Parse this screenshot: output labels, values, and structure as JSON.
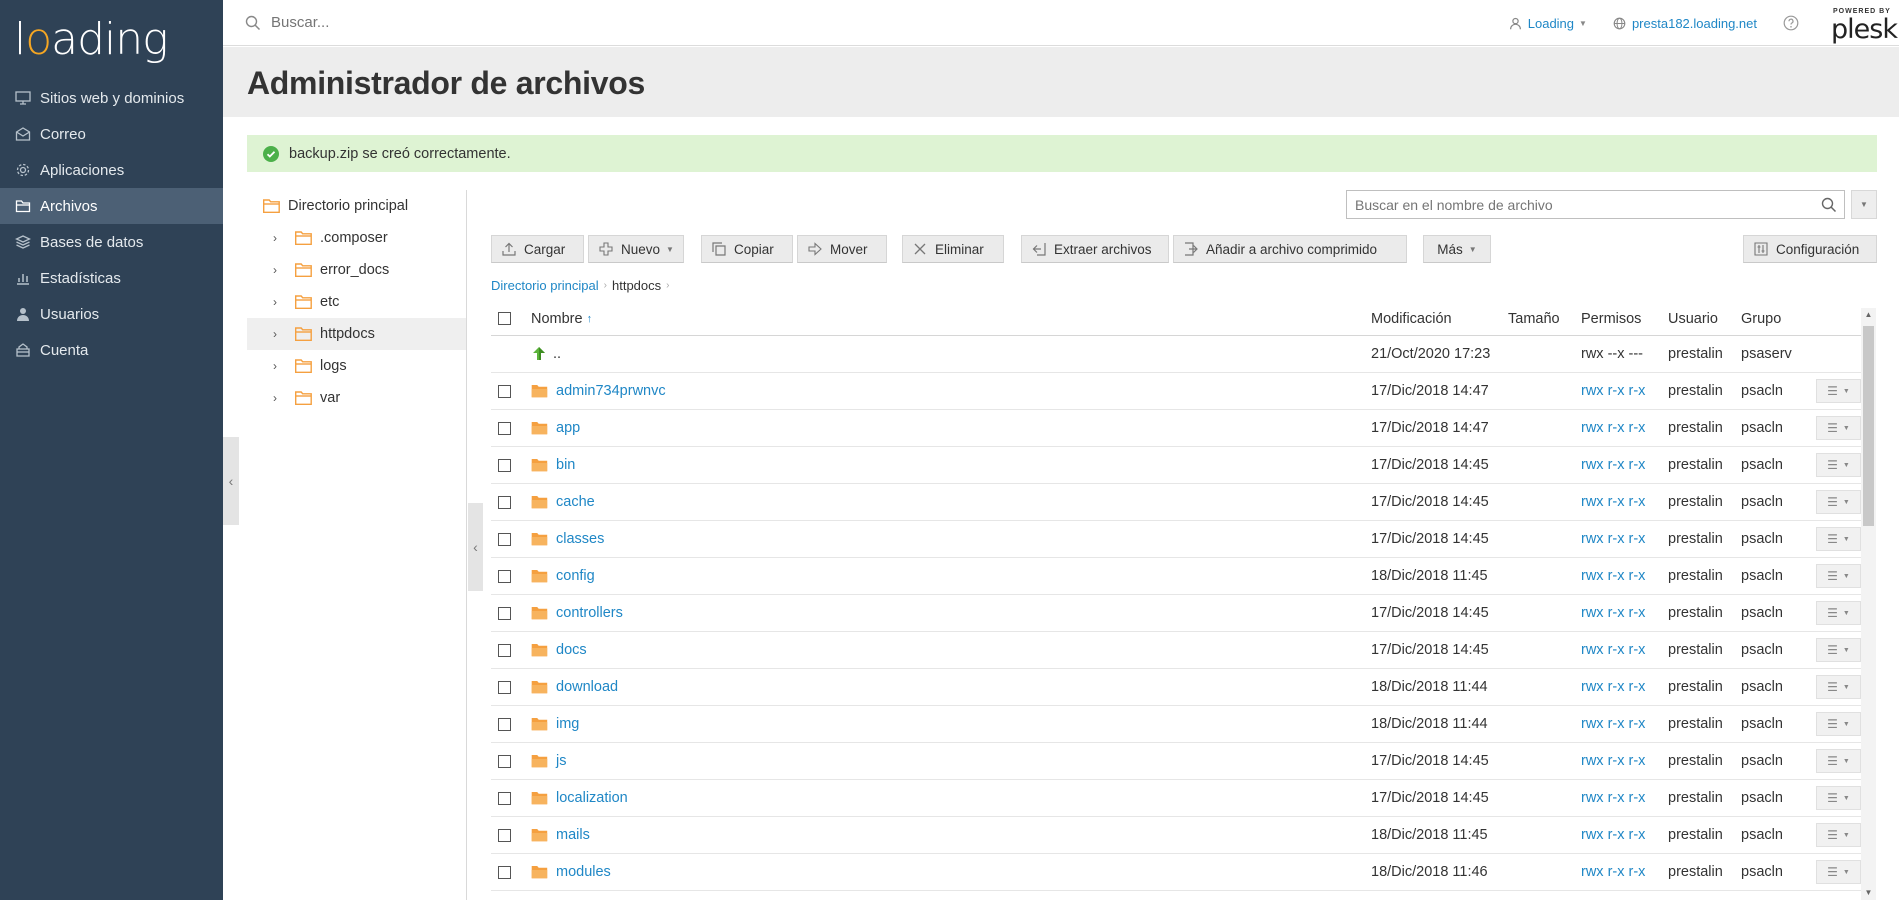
{
  "brand": {
    "logo_pre": "l",
    "logo_o": "o",
    "logo_post": "ading"
  },
  "sidebar": {
    "items": [
      {
        "label": "Sitios web y dominios",
        "icon": "monitor-icon"
      },
      {
        "label": "Correo",
        "icon": "mail-icon"
      },
      {
        "label": "Aplicaciones",
        "icon": "gear-icon"
      },
      {
        "label": "Archivos",
        "icon": "folder-icon",
        "active": true
      },
      {
        "label": "Bases de datos",
        "icon": "database-icon"
      },
      {
        "label": "Estadísticas",
        "icon": "chart-icon"
      },
      {
        "label": "Usuarios",
        "icon": "user-icon"
      },
      {
        "label": "Cuenta",
        "icon": "account-icon"
      }
    ]
  },
  "topbar": {
    "search_placeholder": "Buscar...",
    "user_label": "Loading",
    "domain_label": "presta182.loading.net",
    "plesk_small": "POWERED BY",
    "plesk_big": "plesk"
  },
  "page": {
    "title": "Administrador de archivos"
  },
  "message": {
    "text": "backup.zip se creó correctamente."
  },
  "tree": {
    "root": "Directorio principal",
    "items": [
      {
        "label": ".composer"
      },
      {
        "label": "error_docs"
      },
      {
        "label": "etc"
      },
      {
        "label": "httpdocs",
        "selected": true
      },
      {
        "label": "logs"
      },
      {
        "label": "var"
      }
    ]
  },
  "file_search": {
    "placeholder": "Buscar en el nombre de archivo"
  },
  "toolbar": {
    "upload": "Cargar",
    "new": "Nuevo",
    "copy": "Copiar",
    "move": "Mover",
    "delete": "Eliminar",
    "extract": "Extraer archivos",
    "add_archive": "Añadir a archivo comprimido",
    "more": "Más",
    "settings": "Configuración"
  },
  "breadcrumb": {
    "root": "Directorio principal",
    "current": "httpdocs"
  },
  "table": {
    "headers": {
      "name": "Nombre",
      "sort_arrow": "↑",
      "modified": "Modificación",
      "size": "Tamaño",
      "permissions": "Permisos",
      "user": "Usuario",
      "group": "Grupo"
    },
    "parent": {
      "name": "..",
      "modified": "21/Oct/2020 17:23",
      "permissions": "rwx --x ---",
      "user": "prestalin",
      "group": "psaserv"
    },
    "rows": [
      {
        "name": "admin734prwnvc",
        "modified": "17/Dic/2018 14:47",
        "permissions": "rwx r-x r-x",
        "user": "prestalin",
        "group": "psacln"
      },
      {
        "name": "app",
        "modified": "17/Dic/2018 14:47",
        "permissions": "rwx r-x r-x",
        "user": "prestalin",
        "group": "psacln"
      },
      {
        "name": "bin",
        "modified": "17/Dic/2018 14:45",
        "permissions": "rwx r-x r-x",
        "user": "prestalin",
        "group": "psacln"
      },
      {
        "name": "cache",
        "modified": "17/Dic/2018 14:45",
        "permissions": "rwx r-x r-x",
        "user": "prestalin",
        "group": "psacln"
      },
      {
        "name": "classes",
        "modified": "17/Dic/2018 14:45",
        "permissions": "rwx r-x r-x",
        "user": "prestalin",
        "group": "psacln"
      },
      {
        "name": "config",
        "modified": "18/Dic/2018 11:45",
        "permissions": "rwx r-x r-x",
        "user": "prestalin",
        "group": "psacln"
      },
      {
        "name": "controllers",
        "modified": "17/Dic/2018 14:45",
        "permissions": "rwx r-x r-x",
        "user": "prestalin",
        "group": "psacln"
      },
      {
        "name": "docs",
        "modified": "17/Dic/2018 14:45",
        "permissions": "rwx r-x r-x",
        "user": "prestalin",
        "group": "psacln"
      },
      {
        "name": "download",
        "modified": "18/Dic/2018 11:44",
        "permissions": "rwx r-x r-x",
        "user": "prestalin",
        "group": "psacln"
      },
      {
        "name": "img",
        "modified": "18/Dic/2018 11:44",
        "permissions": "rwx r-x r-x",
        "user": "prestalin",
        "group": "psacln"
      },
      {
        "name": "js",
        "modified": "17/Dic/2018 14:45",
        "permissions": "rwx r-x r-x",
        "user": "prestalin",
        "group": "psacln"
      },
      {
        "name": "localization",
        "modified": "17/Dic/2018 14:45",
        "permissions": "rwx r-x r-x",
        "user": "prestalin",
        "group": "psacln"
      },
      {
        "name": "mails",
        "modified": "18/Dic/2018 11:45",
        "permissions": "rwx r-x r-x",
        "user": "prestalin",
        "group": "psacln"
      },
      {
        "name": "modules",
        "modified": "18/Dic/2018 11:46",
        "permissions": "rwx r-x r-x",
        "user": "prestalin",
        "group": "psacln"
      }
    ]
  },
  "colors": {
    "sidebar": "#2f4256",
    "sidebar_active": "#4c6075",
    "link": "#1f87c6",
    "folder": "#f5a040",
    "success_bg": "#def3d3",
    "success_icon": "#4cb04a"
  }
}
